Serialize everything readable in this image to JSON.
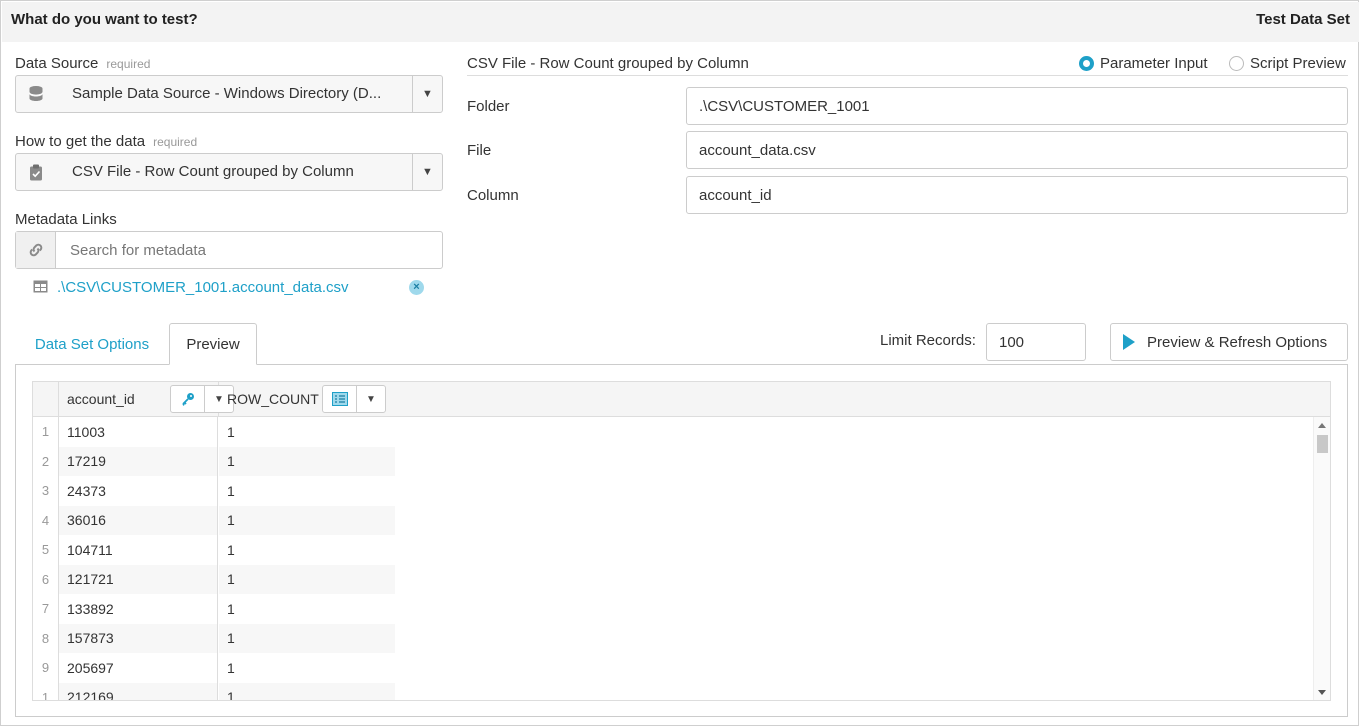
{
  "header": {
    "title": "What do you want to test?",
    "right_title": "Test Data Set"
  },
  "data_source": {
    "label": "Data Source",
    "required": "required",
    "value": "Sample Data Source - Windows Directory (D..."
  },
  "how_to_get": {
    "label": "How to get the data",
    "required": "required",
    "value": "CSV File - Row Count grouped by Column"
  },
  "metadata": {
    "label": "Metadata Links",
    "placeholder": "Search for metadata",
    "link_text": ".\\CSV\\CUSTOMER_1001.account_data.csv",
    "remove_glyph": "×"
  },
  "params": {
    "section_title": "CSV File - Row Count grouped by Column",
    "radio_parameter_input": "Parameter Input",
    "radio_script_preview": "Script Preview",
    "selected_mode": "Parameter Input",
    "fields": [
      {
        "label": "Folder",
        "value": ".\\CSV\\CUSTOMER_1001"
      },
      {
        "label": "File",
        "value": "account_data.csv"
      },
      {
        "label": "Column",
        "value": "account_id"
      }
    ]
  },
  "tabs": {
    "data_set_options": "Data Set Options",
    "preview": "Preview",
    "active": "Preview"
  },
  "toolbar": {
    "limit_label": "Limit Records:",
    "limit_value": "100",
    "preview_button": "Preview & Refresh Options"
  },
  "grid": {
    "columns": [
      "account_id",
      "ROW_COUNT"
    ],
    "rows": [
      {
        "n": "1",
        "account_id": "11003",
        "row_count": "1"
      },
      {
        "n": "2",
        "account_id": "17219",
        "row_count": "1"
      },
      {
        "n": "3",
        "account_id": "24373",
        "row_count": "1"
      },
      {
        "n": "4",
        "account_id": "36016",
        "row_count": "1"
      },
      {
        "n": "5",
        "account_id": "104711",
        "row_count": "1"
      },
      {
        "n": "6",
        "account_id": "121721",
        "row_count": "1"
      },
      {
        "n": "7",
        "account_id": "133892",
        "row_count": "1"
      },
      {
        "n": "8",
        "account_id": "157873",
        "row_count": "1"
      },
      {
        "n": "9",
        "account_id": "205697",
        "row_count": "1"
      },
      {
        "n": "1",
        "account_id": "212169",
        "row_count": "1"
      }
    ]
  },
  "colors": {
    "accent": "#1ea0c8",
    "border": "#cccccc",
    "header_bg": "#f3f3f3"
  }
}
